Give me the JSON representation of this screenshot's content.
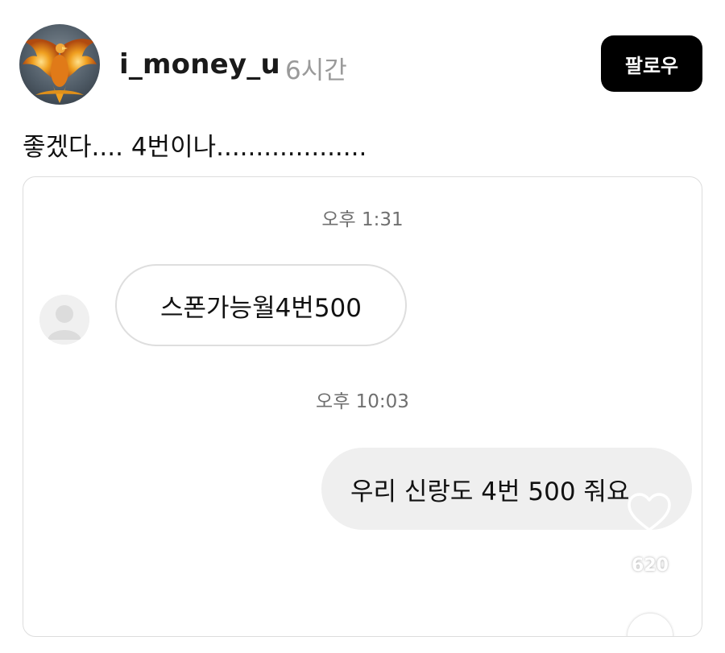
{
  "post": {
    "username": "i_money_u",
    "time_ago": "6시간",
    "follow_label": "팔로우",
    "text": "좋겠다.... 4번이나...................",
    "avatar_icon": "phoenix-avatar-icon"
  },
  "media": {
    "messages": [
      {
        "type": "timestamp",
        "text": "오후 1:31"
      },
      {
        "type": "received",
        "text": "스폰가능월4번500"
      },
      {
        "type": "timestamp",
        "text": "오후 10:03"
      },
      {
        "type": "sent",
        "text": "우리 신랑도 4번 500 줘요"
      }
    ],
    "sender_avatar_icon": "default-profile-icon"
  },
  "actions": {
    "like_icon": "heart-icon",
    "like_count": "620",
    "comment_icon": "comment-icon"
  },
  "colors": {
    "follow_button_bg": "#000000",
    "sent_bubble_bg": "#efefef",
    "received_bubble_border": "#dedede",
    "muted_text": "#9a9a9a"
  }
}
